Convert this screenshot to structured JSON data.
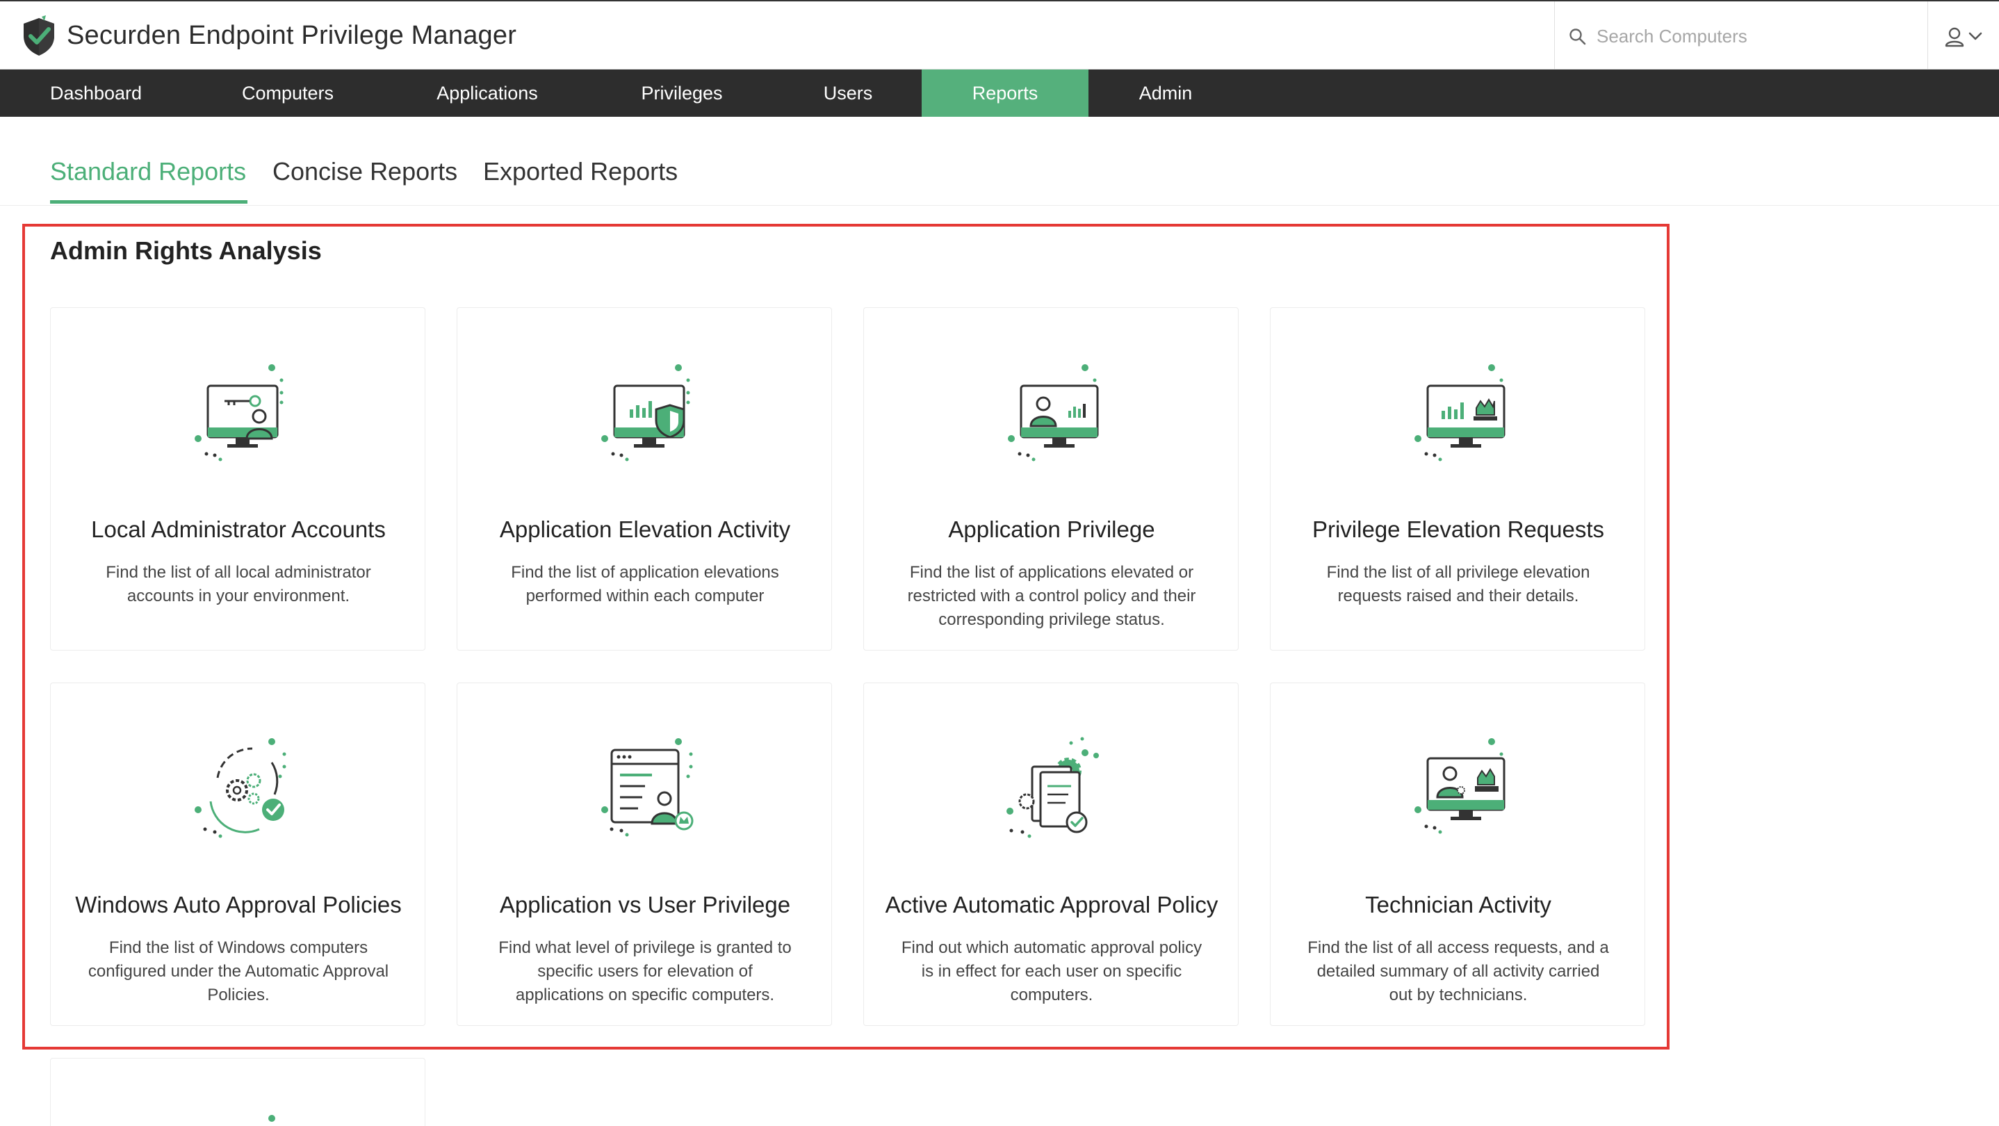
{
  "app": {
    "title": "Securden Endpoint Privilege Manager",
    "brand_color": "#4caf78",
    "logo_icon": "shield-check-icon"
  },
  "search": {
    "placeholder": "Search Computers",
    "value": ""
  },
  "nav": {
    "items": [
      {
        "label": "Dashboard",
        "active": false
      },
      {
        "label": "Computers",
        "active": false
      },
      {
        "label": "Applications",
        "active": false
      },
      {
        "label": "Privileges",
        "active": false
      },
      {
        "label": "Users",
        "active": false
      },
      {
        "label": "Reports",
        "active": true
      },
      {
        "label": "Admin",
        "active": false
      }
    ]
  },
  "tabs": [
    {
      "label": "Standard Reports",
      "active": true
    },
    {
      "label": "Concise Reports",
      "active": false
    },
    {
      "label": "Exported Reports",
      "active": false
    }
  ],
  "section": {
    "title": "Admin Rights Analysis"
  },
  "cards": [
    {
      "title": "Local Administrator Accounts",
      "description": "Find the list of all local administrator accounts in your environment.",
      "icon": "monitor-key-user-icon"
    },
    {
      "title": "Application Elevation Activity",
      "description": "Find the list of application elevations performed within each computer",
      "icon": "monitor-chart-shield-icon"
    },
    {
      "title": "Application Privilege",
      "description": "Find the list of applications elevated or restricted with a control policy and their corresponding privilege status.",
      "icon": "monitor-user-chart-icon"
    },
    {
      "title": "Privilege Elevation Requests",
      "description": "Find the list of all privilege elevation requests raised and their details.",
      "icon": "monitor-chart-crown-icon"
    },
    {
      "title": "Windows Auto Approval Policies",
      "description": "Find the list of Windows computers configured under the Automatic Approval Policies.",
      "icon": "gears-cycle-check-icon"
    },
    {
      "title": "Application vs User Privilege",
      "description": "Find what level of privilege is granted to specific users for elevation of applications on specific computers.",
      "icon": "window-list-user-crown-icon"
    },
    {
      "title": "Active Automatic Approval Policy",
      "description": "Find out which automatic approval policy is in effect for each user on specific computers.",
      "icon": "document-gear-check-icon"
    },
    {
      "title": "Technician Activity",
      "description": "Find the list of all access requests, and a detailed summary of all activity carried out by technicians.",
      "icon": "monitor-technician-icon"
    }
  ]
}
